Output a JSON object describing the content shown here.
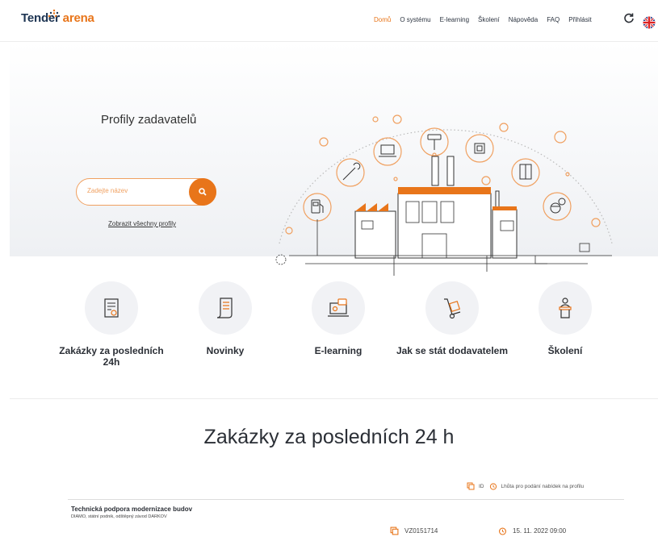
{
  "brand": {
    "part1": "Tender",
    "part2": "arena",
    "primary_color": "#e8751a",
    "dark_color": "#1e3553"
  },
  "nav": {
    "items": [
      {
        "label": "Domů",
        "active": true
      },
      {
        "label": "O systému",
        "active": false
      },
      {
        "label": "E-learning",
        "active": false
      },
      {
        "label": "Školení",
        "active": false
      },
      {
        "label": "Nápověda",
        "active": false
      },
      {
        "label": "FAQ",
        "active": false
      },
      {
        "label": "Přihlásit",
        "active": false
      }
    ],
    "icons": [
      "refresh-icon",
      "uk-flag-icon"
    ]
  },
  "hero": {
    "title": "Profily zadavatelů",
    "search_placeholder": "Zadejte název",
    "search_icon": "search-icon",
    "all_profiles_link": "Zobrazit všechny profily"
  },
  "categories": [
    {
      "label": "Zakázky za posledních 24h",
      "icon": "document-certificate-icon"
    },
    {
      "label": "Novinky",
      "icon": "scroll-icon"
    },
    {
      "label": "E-learning",
      "icon": "laptop-chat-icon"
    },
    {
      "label": "Jak se stát dodavatelem",
      "icon": "hand-truck-icon"
    },
    {
      "label": "Školení",
      "icon": "lecturer-podium-icon"
    }
  ],
  "section": {
    "title": "Zakázky za posledních 24 h"
  },
  "legend": {
    "id_label": "ID",
    "deadline_label": "Lhůta pro podání nabídek na profilu"
  },
  "tenders": [
    {
      "title": "Technická podpora modernizace budov",
      "organization": "DIAMO, státní podnik, odštěpný závod DARKOV",
      "id": "VZ0151714",
      "deadline": "15. 11. 2022 09:00"
    }
  ]
}
